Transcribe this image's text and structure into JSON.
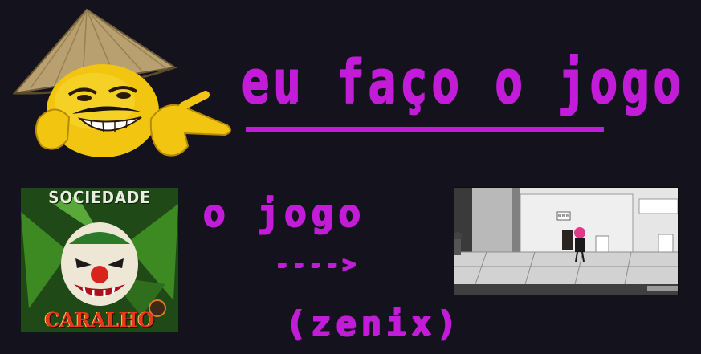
{
  "headline": "eu faço o jogo",
  "subtitle": "o jogo",
  "arrow": "---->",
  "credit": "(zenix)",
  "album_cover": {
    "top_text": "SOCIEDADE",
    "bottom_text": "CARALHO"
  },
  "game_sign": "WWW",
  "colors": {
    "background": "#14121d",
    "accent": "#c21cd9"
  }
}
